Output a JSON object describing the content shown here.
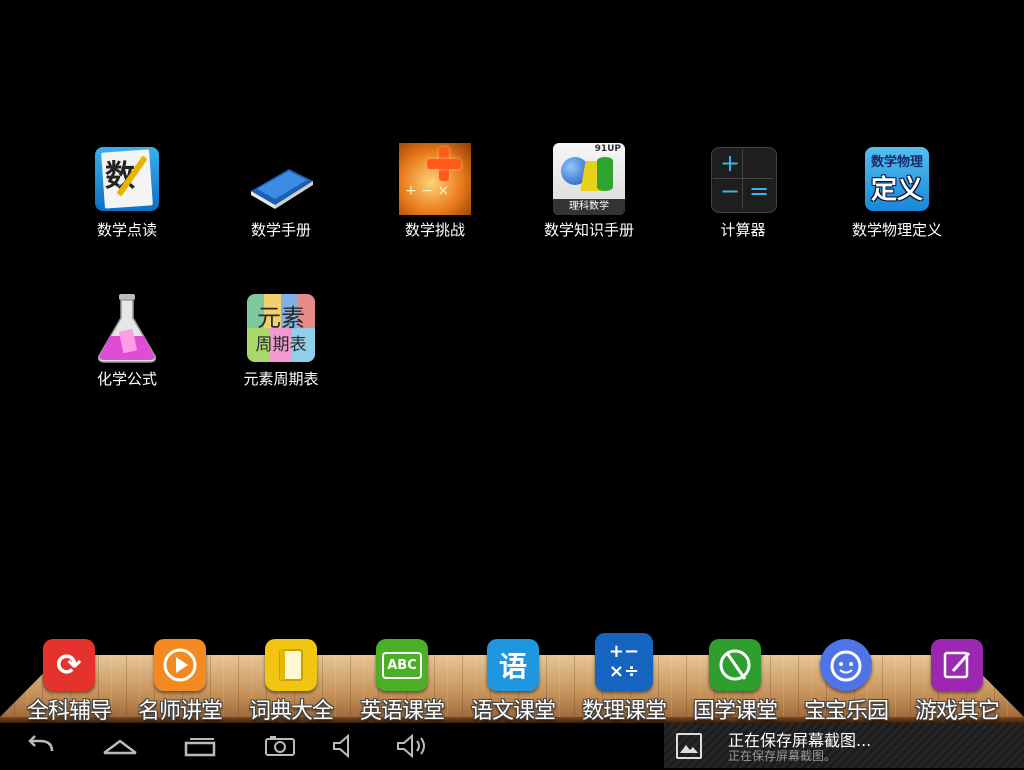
{
  "desktop": {
    "apps": [
      {
        "label": "数学点读",
        "icon": "math-reader-icon"
      },
      {
        "label": "数学手册",
        "icon": "blue-book-icon"
      },
      {
        "label": "数学挑战",
        "icon": "math-challenge-icon"
      },
      {
        "label": "数学知识手册",
        "icon": "math-handbook-icon",
        "badge": "91UP",
        "caption": "理科数学"
      },
      {
        "label": "计算器",
        "icon": "calculator-icon"
      },
      {
        "label": "数学物理定义",
        "icon": "definition-icon",
        "text1": "数学物理",
        "text2": "定义"
      },
      {
        "label": "化学公式",
        "icon": "flask-icon"
      },
      {
        "label": "元素周期表",
        "icon": "periodic-table-icon",
        "text1": "元素",
        "text2": "周期表"
      }
    ],
    "math_reader_glyph": "数"
  },
  "dock": {
    "items": [
      {
        "label": "全科辅导",
        "icon": "refresh-icon",
        "color": "#e5322d"
      },
      {
        "label": "名师讲堂",
        "icon": "play-icon",
        "color": "#f28a21"
      },
      {
        "label": "词典大全",
        "icon": "book-icon",
        "color": "#f2c511"
      },
      {
        "label": "英语课堂",
        "icon": "abc-icon",
        "color": "#4caf28",
        "glyph": "ABC"
      },
      {
        "label": "语文课堂",
        "icon": "chinese-icon",
        "color": "#1f96e0",
        "glyph": "语"
      },
      {
        "label": "数理课堂",
        "icon": "math-ops-icon",
        "color": "#1565c0",
        "glyph": "+−\n×÷"
      },
      {
        "label": "国学课堂",
        "icon": "scroll-icon",
        "color": "#2e9e2e"
      },
      {
        "label": "宝宝乐园",
        "icon": "baby-face-icon",
        "color": "#4f74e8"
      },
      {
        "label": "游戏其它",
        "icon": "edit-icon",
        "color": "#9c27b0"
      }
    ]
  },
  "notification": {
    "title": "正在保存屏幕截图...",
    "subtitle": "正在保存屏幕截图。"
  }
}
